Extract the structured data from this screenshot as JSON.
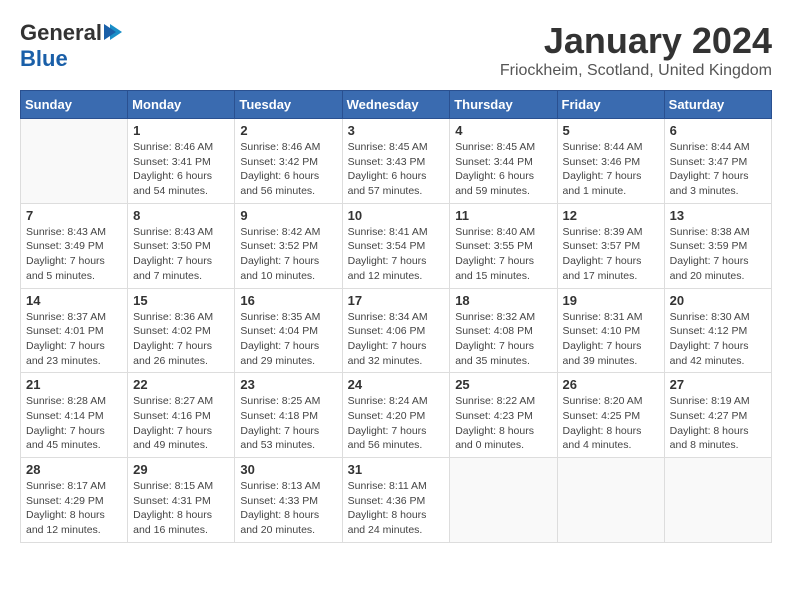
{
  "header": {
    "logo_line1": "General",
    "logo_line2": "Blue",
    "title": "January 2024",
    "subtitle": "Friockheim, Scotland, United Kingdom"
  },
  "weekdays": [
    "Sunday",
    "Monday",
    "Tuesday",
    "Wednesday",
    "Thursday",
    "Friday",
    "Saturday"
  ],
  "weeks": [
    [
      {
        "day": "",
        "info": ""
      },
      {
        "day": "1",
        "info": "Sunrise: 8:46 AM\nSunset: 3:41 PM\nDaylight: 6 hours\nand 54 minutes."
      },
      {
        "day": "2",
        "info": "Sunrise: 8:46 AM\nSunset: 3:42 PM\nDaylight: 6 hours\nand 56 minutes."
      },
      {
        "day": "3",
        "info": "Sunrise: 8:45 AM\nSunset: 3:43 PM\nDaylight: 6 hours\nand 57 minutes."
      },
      {
        "day": "4",
        "info": "Sunrise: 8:45 AM\nSunset: 3:44 PM\nDaylight: 6 hours\nand 59 minutes."
      },
      {
        "day": "5",
        "info": "Sunrise: 8:44 AM\nSunset: 3:46 PM\nDaylight: 7 hours\nand 1 minute."
      },
      {
        "day": "6",
        "info": "Sunrise: 8:44 AM\nSunset: 3:47 PM\nDaylight: 7 hours\nand 3 minutes."
      }
    ],
    [
      {
        "day": "7",
        "info": "Sunrise: 8:43 AM\nSunset: 3:49 PM\nDaylight: 7 hours\nand 5 minutes."
      },
      {
        "day": "8",
        "info": "Sunrise: 8:43 AM\nSunset: 3:50 PM\nDaylight: 7 hours\nand 7 minutes."
      },
      {
        "day": "9",
        "info": "Sunrise: 8:42 AM\nSunset: 3:52 PM\nDaylight: 7 hours\nand 10 minutes."
      },
      {
        "day": "10",
        "info": "Sunrise: 8:41 AM\nSunset: 3:54 PM\nDaylight: 7 hours\nand 12 minutes."
      },
      {
        "day": "11",
        "info": "Sunrise: 8:40 AM\nSunset: 3:55 PM\nDaylight: 7 hours\nand 15 minutes."
      },
      {
        "day": "12",
        "info": "Sunrise: 8:39 AM\nSunset: 3:57 PM\nDaylight: 7 hours\nand 17 minutes."
      },
      {
        "day": "13",
        "info": "Sunrise: 8:38 AM\nSunset: 3:59 PM\nDaylight: 7 hours\nand 20 minutes."
      }
    ],
    [
      {
        "day": "14",
        "info": "Sunrise: 8:37 AM\nSunset: 4:01 PM\nDaylight: 7 hours\nand 23 minutes."
      },
      {
        "day": "15",
        "info": "Sunrise: 8:36 AM\nSunset: 4:02 PM\nDaylight: 7 hours\nand 26 minutes."
      },
      {
        "day": "16",
        "info": "Sunrise: 8:35 AM\nSunset: 4:04 PM\nDaylight: 7 hours\nand 29 minutes."
      },
      {
        "day": "17",
        "info": "Sunrise: 8:34 AM\nSunset: 4:06 PM\nDaylight: 7 hours\nand 32 minutes."
      },
      {
        "day": "18",
        "info": "Sunrise: 8:32 AM\nSunset: 4:08 PM\nDaylight: 7 hours\nand 35 minutes."
      },
      {
        "day": "19",
        "info": "Sunrise: 8:31 AM\nSunset: 4:10 PM\nDaylight: 7 hours\nand 39 minutes."
      },
      {
        "day": "20",
        "info": "Sunrise: 8:30 AM\nSunset: 4:12 PM\nDaylight: 7 hours\nand 42 minutes."
      }
    ],
    [
      {
        "day": "21",
        "info": "Sunrise: 8:28 AM\nSunset: 4:14 PM\nDaylight: 7 hours\nand 45 minutes."
      },
      {
        "day": "22",
        "info": "Sunrise: 8:27 AM\nSunset: 4:16 PM\nDaylight: 7 hours\nand 49 minutes."
      },
      {
        "day": "23",
        "info": "Sunrise: 8:25 AM\nSunset: 4:18 PM\nDaylight: 7 hours\nand 53 minutes."
      },
      {
        "day": "24",
        "info": "Sunrise: 8:24 AM\nSunset: 4:20 PM\nDaylight: 7 hours\nand 56 minutes."
      },
      {
        "day": "25",
        "info": "Sunrise: 8:22 AM\nSunset: 4:23 PM\nDaylight: 8 hours\nand 0 minutes."
      },
      {
        "day": "26",
        "info": "Sunrise: 8:20 AM\nSunset: 4:25 PM\nDaylight: 8 hours\nand 4 minutes."
      },
      {
        "day": "27",
        "info": "Sunrise: 8:19 AM\nSunset: 4:27 PM\nDaylight: 8 hours\nand 8 minutes."
      }
    ],
    [
      {
        "day": "28",
        "info": "Sunrise: 8:17 AM\nSunset: 4:29 PM\nDaylight: 8 hours\nand 12 minutes."
      },
      {
        "day": "29",
        "info": "Sunrise: 8:15 AM\nSunset: 4:31 PM\nDaylight: 8 hours\nand 16 minutes."
      },
      {
        "day": "30",
        "info": "Sunrise: 8:13 AM\nSunset: 4:33 PM\nDaylight: 8 hours\nand 20 minutes."
      },
      {
        "day": "31",
        "info": "Sunrise: 8:11 AM\nSunset: 4:36 PM\nDaylight: 8 hours\nand 24 minutes."
      },
      {
        "day": "",
        "info": ""
      },
      {
        "day": "",
        "info": ""
      },
      {
        "day": "",
        "info": ""
      }
    ]
  ]
}
